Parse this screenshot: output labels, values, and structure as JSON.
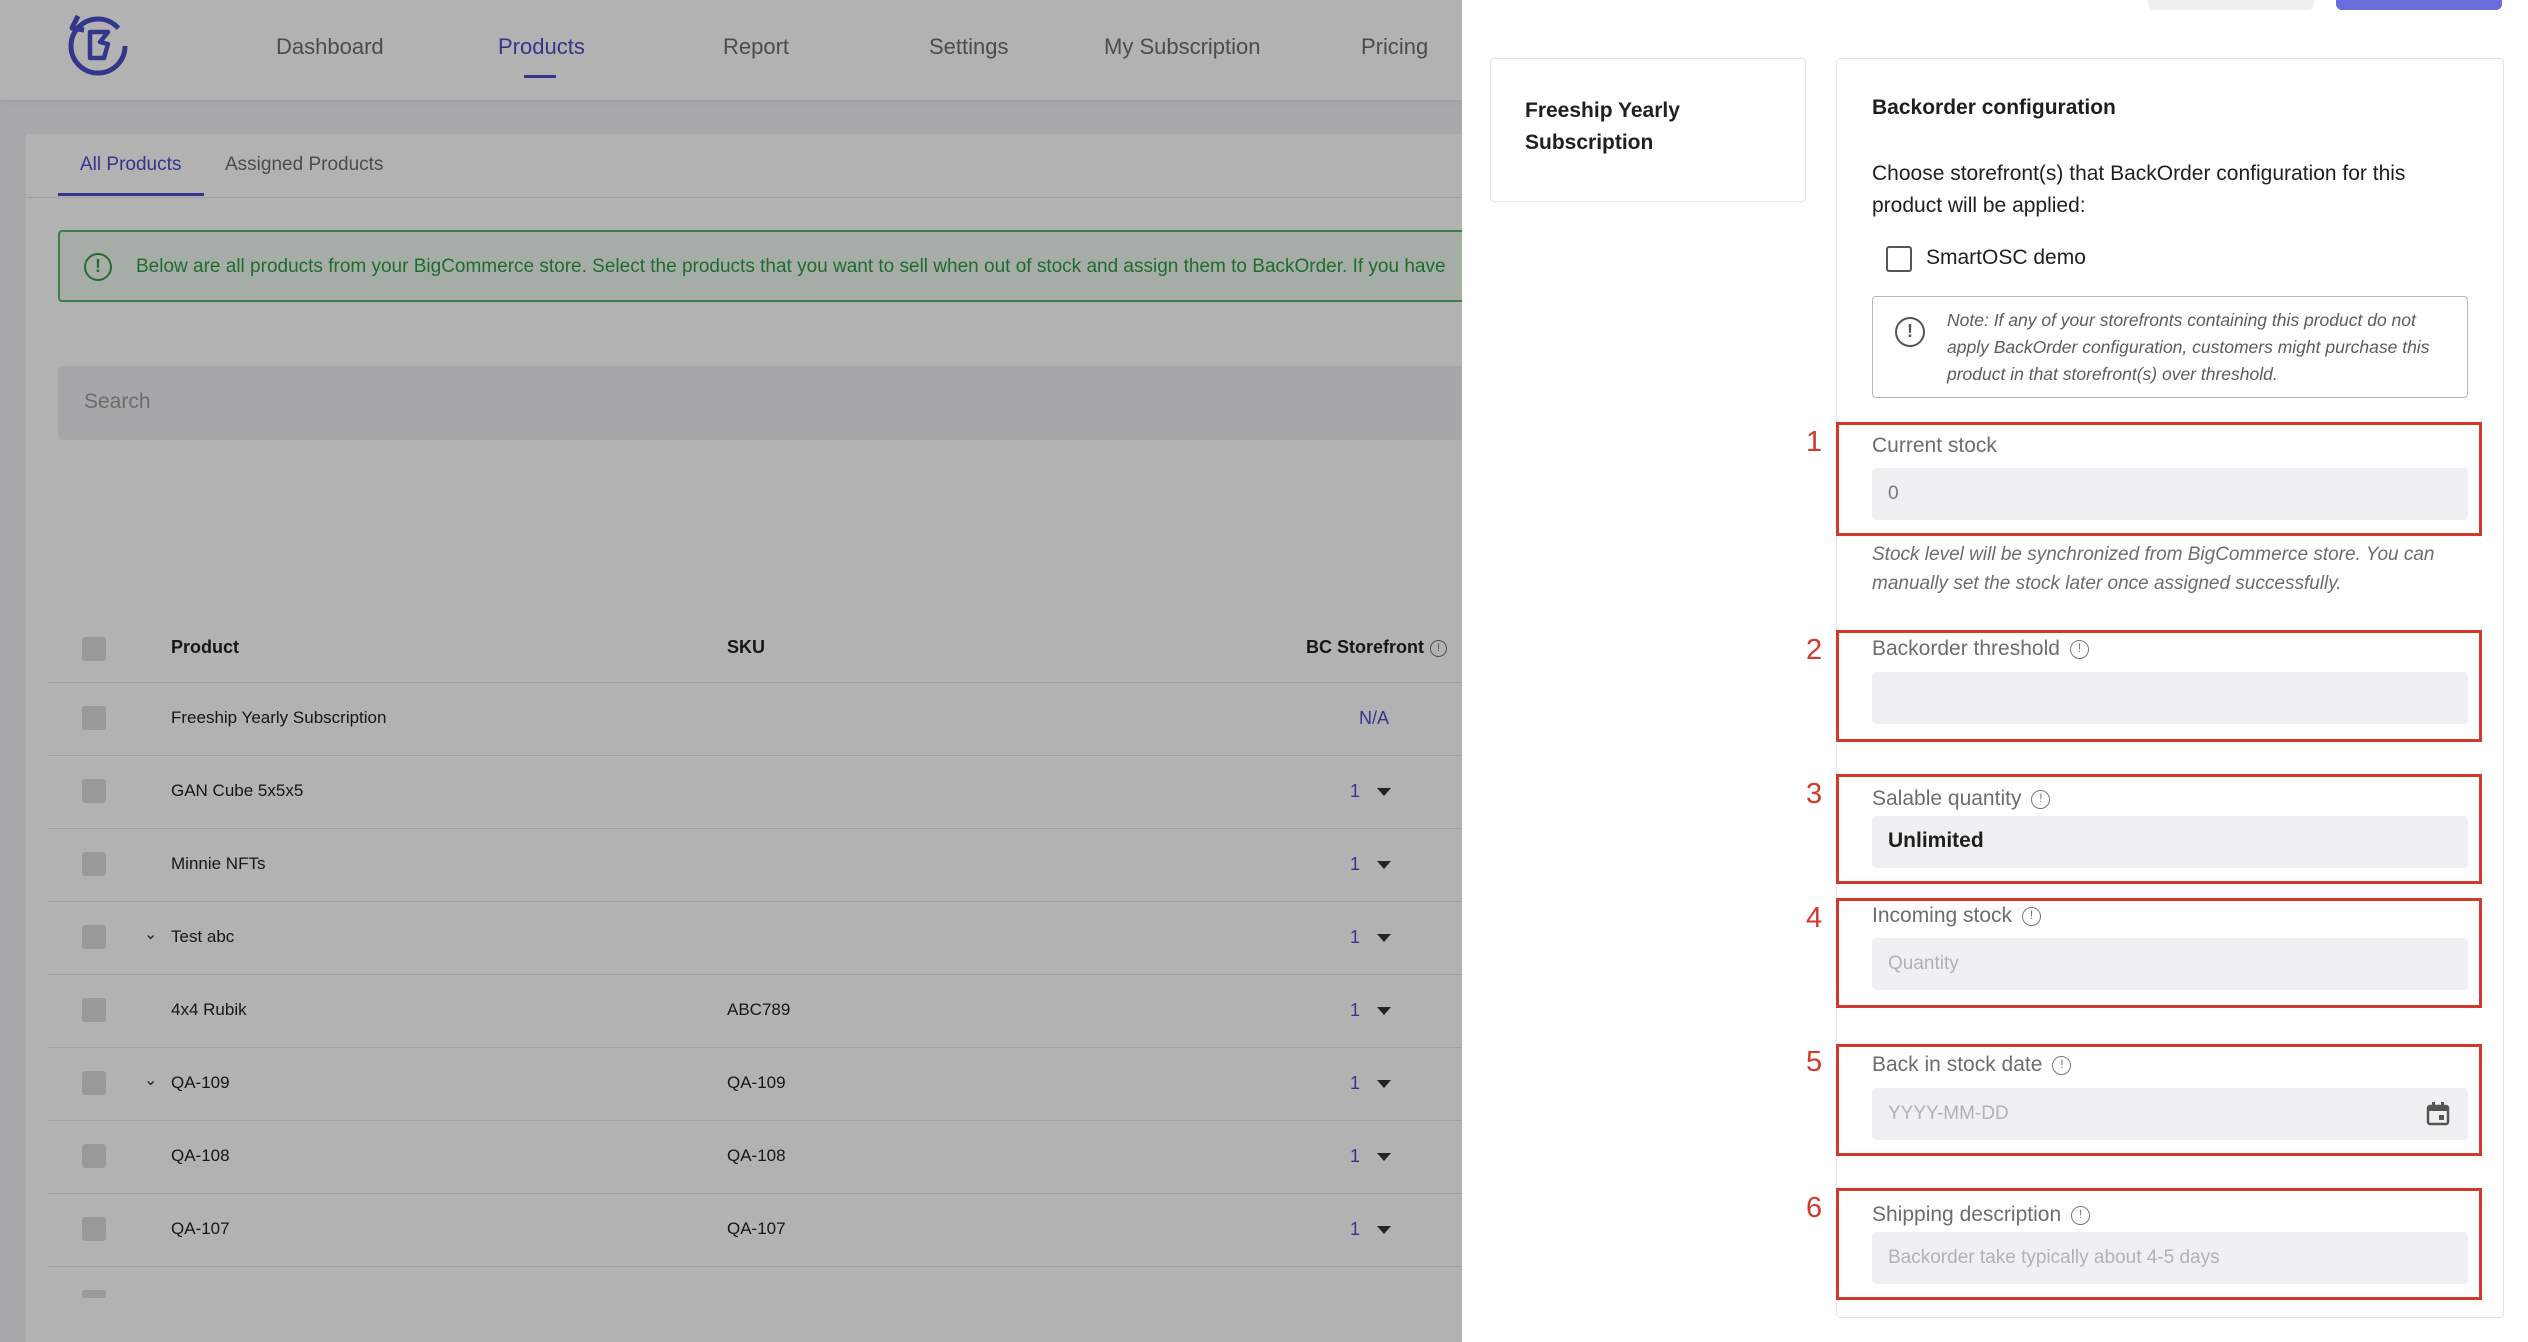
{
  "nav": {
    "items": [
      "Dashboard",
      "Products",
      "Report",
      "Settings",
      "My Subscription",
      "Pricing"
    ],
    "active": "Products"
  },
  "tabs": {
    "all_products": "All Products",
    "assigned_products": "Assigned Products"
  },
  "alert": {
    "text": "Below are all products from your BigCommerce store. Select the products that you want to sell when out of stock and assign them to BackOrder. If you have"
  },
  "search": {
    "placeholder": "Search"
  },
  "table": {
    "headers": {
      "product": "Product",
      "sku": "SKU",
      "storefront": "BC Storefront"
    },
    "rows": [
      {
        "product": "Freeship Yearly Subscription",
        "sku": "",
        "storefront": "N/A"
      },
      {
        "product": "GAN Cube 5x5x5",
        "sku": "",
        "storefront": "1"
      },
      {
        "product": "Minnie NFTs",
        "sku": "",
        "storefront": "1"
      },
      {
        "product": "Test abc",
        "sku": "",
        "storefront": "1"
      },
      {
        "product": "4x4 Rubik",
        "sku": "ABC789",
        "storefront": "1"
      },
      {
        "product": "QA-109",
        "sku": "QA-109",
        "storefront": "1"
      },
      {
        "product": "QA-108",
        "sku": "QA-108",
        "storefront": "1"
      },
      {
        "product": "QA-107",
        "sku": "QA-107",
        "storefront": "1"
      }
    ]
  },
  "drawer": {
    "product_name": "Freeship Yearly Subscription",
    "section_title": "Backorder configuration",
    "section_desc": "Choose storefront(s) that BackOrder configuration for this product will be applied:",
    "storefront_label": "SmartOSC demo",
    "note": "Note: If any of your storefronts containing this product do not apply BackOrder configuration, customers might purchase this product in that storefront(s) over threshold.",
    "fields": {
      "current_stock": {
        "label": "Current stock",
        "value": "0"
      },
      "stock_help": "Stock level will be synchronized from BigCommerce store. You can manually set the stock later once assigned successfully.",
      "backorder_threshold": {
        "label": "Backorder threshold",
        "value": ""
      },
      "salable_quantity": {
        "label": "Salable quantity",
        "value": "Unlimited"
      },
      "incoming_stock": {
        "label": "Incoming stock",
        "placeholder": "Quantity"
      },
      "back_in_stock_date": {
        "label": "Back in stock date",
        "placeholder": "YYYY-MM-DD"
      },
      "shipping_description": {
        "label": "Shipping description",
        "placeholder": "Backorder take typically about 4-5 days"
      }
    },
    "annotations": [
      "1",
      "2",
      "3",
      "4",
      "5",
      "6"
    ]
  },
  "colors": {
    "accent": "#4b4ec9",
    "annotation_red": "#d3382c",
    "alert_green": "#2e9a44"
  }
}
